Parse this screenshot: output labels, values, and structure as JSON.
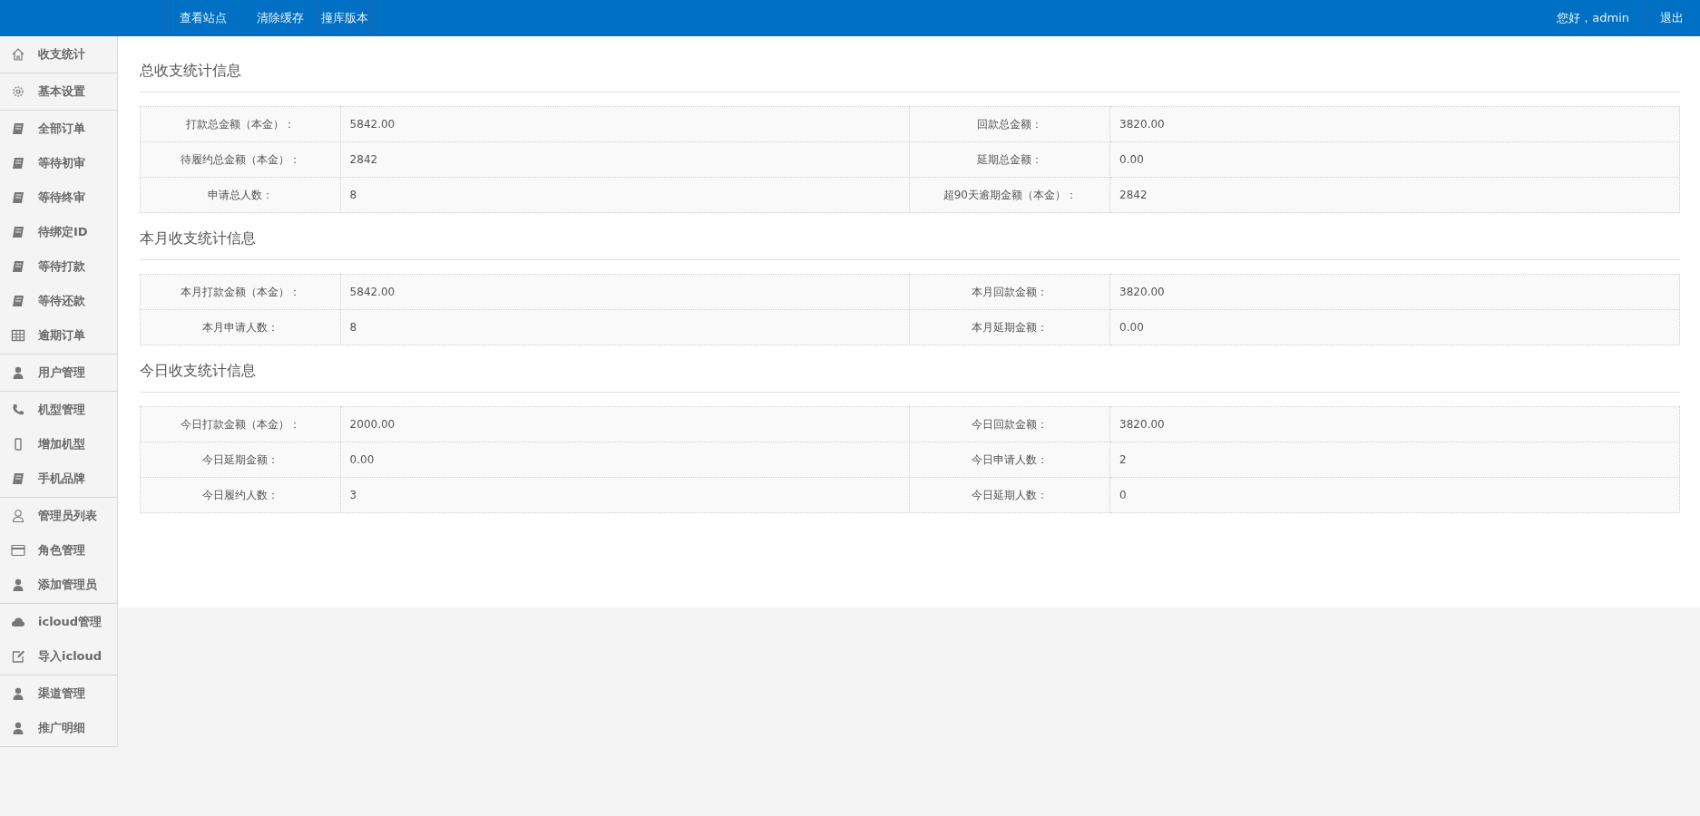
{
  "top_nav": {
    "links": [
      "查看站点",
      "清除缓存",
      "撞库版本"
    ],
    "greeting": "您好，admin",
    "logout": "退出"
  },
  "sidebar": {
    "groups": [
      {
        "items": [
          {
            "label": "收支统计",
            "kind": "home"
          }
        ]
      },
      {
        "items": [
          {
            "label": "基本设置",
            "kind": "gear"
          }
        ]
      },
      {
        "items": [
          {
            "label": "全部订单",
            "kind": "book"
          },
          {
            "label": "等待初审",
            "kind": "book"
          },
          {
            "label": "等待终审",
            "kind": "book"
          },
          {
            "label": "待绑定ID",
            "kind": "book"
          },
          {
            "label": "等待打款",
            "kind": "book"
          },
          {
            "label": "等待还款",
            "kind": "book"
          },
          {
            "label": "逾期订单",
            "kind": "table"
          }
        ]
      },
      {
        "items": [
          {
            "label": "用户管理",
            "kind": "user"
          }
        ]
      },
      {
        "items": [
          {
            "label": "机型管理",
            "kind": "phone"
          },
          {
            "label": "增加机型",
            "kind": "mobile"
          },
          {
            "label": "手机品牌",
            "kind": "book"
          }
        ]
      },
      {
        "items": [
          {
            "label": "管理员列表",
            "kind": "useroutline"
          },
          {
            "label": "角色管理",
            "kind": "card"
          },
          {
            "label": "添加管理员",
            "kind": "user"
          }
        ]
      },
      {
        "items": [
          {
            "label": "icloud管理",
            "kind": "cloud"
          },
          {
            "label": "导入icloud",
            "kind": "edit"
          }
        ]
      },
      {
        "items": [
          {
            "label": "渠道管理",
            "kind": "user"
          },
          {
            "label": "推广明细",
            "kind": "user"
          }
        ]
      }
    ]
  },
  "sections": [
    {
      "title": "总收支统计信息",
      "rows": [
        [
          {
            "label": "打款总金额（本金）：",
            "value": "5842.00"
          },
          {
            "label": "回款总金额：",
            "value": "3820.00"
          }
        ],
        [
          {
            "label": "待履约总金额（本金）：",
            "value": "2842"
          },
          {
            "label": "延期总金额：",
            "value": "0.00"
          }
        ],
        [
          {
            "label": "申请总人数：",
            "value": "8"
          },
          {
            "label": "超90天逾期金额（本金）：",
            "value": "2842"
          }
        ]
      ]
    },
    {
      "title": "本月收支统计信息",
      "rows": [
        [
          {
            "label": "本月打款金额（本金）：",
            "value": "5842.00"
          },
          {
            "label": "本月回款金额：",
            "value": "3820.00"
          }
        ],
        [
          {
            "label": "本月申请人数：",
            "value": "8"
          },
          {
            "label": "本月延期金额：",
            "value": "0.00"
          }
        ]
      ]
    },
    {
      "title": "今日收支统计信息",
      "rows": [
        [
          {
            "label": "今日打款金额（本金）：",
            "value": "2000.00"
          },
          {
            "label": "今日回款金额：",
            "value": "3820.00"
          }
        ],
        [
          {
            "label": "今日延期金额：",
            "value": "0.00"
          },
          {
            "label": "今日申请人数：",
            "value": "2"
          }
        ],
        [
          {
            "label": "今日履约人数：",
            "value": "3"
          },
          {
            "label": "今日延期人数：",
            "value": "0"
          }
        ]
      ]
    }
  ]
}
